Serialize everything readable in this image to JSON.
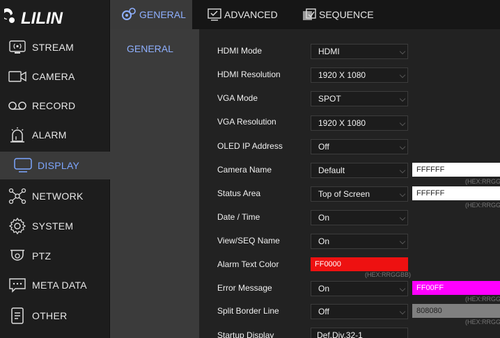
{
  "logo": {
    "text": "LILIN"
  },
  "sidebar": {
    "items": [
      {
        "label": "STREAM",
        "icon": "stream-icon"
      },
      {
        "label": "CAMERA",
        "icon": "camera-icon"
      },
      {
        "label": "RECORD",
        "icon": "record-icon"
      },
      {
        "label": "ALARM",
        "icon": "alarm-icon"
      },
      {
        "label": "DISPLAY",
        "icon": "display-icon",
        "active": true
      },
      {
        "label": "NETWORK",
        "icon": "network-icon"
      },
      {
        "label": "SYSTEM",
        "icon": "system-icon"
      },
      {
        "label": "PTZ",
        "icon": "ptz-icon"
      },
      {
        "label": "META DATA",
        "icon": "metadata-icon"
      },
      {
        "label": "OTHER",
        "icon": "other-icon"
      }
    ]
  },
  "tabs": [
    {
      "label": "GENERAL",
      "active": true
    },
    {
      "label": "ADVANCED"
    },
    {
      "label": "SEQUENCE"
    }
  ],
  "subpanel": {
    "item": "GENERAL"
  },
  "settings": {
    "hdmi_mode": {
      "label": "HDMI Mode",
      "value": "HDMI"
    },
    "hdmi_resolution": {
      "label": "HDMI Resolution",
      "value": "1920 X 1080"
    },
    "vga_mode": {
      "label": "VGA Mode",
      "value": "SPOT"
    },
    "vga_resolution": {
      "label": "VGA Resolution",
      "value": "1920 X 1080"
    },
    "oled_ip": {
      "label": "OLED IP Address",
      "value": "Off"
    },
    "camera_name": {
      "label": "Camera Name",
      "value": "Default",
      "color": "FFFFFF",
      "hint": "(HEX:RRGGB"
    },
    "status_area": {
      "label": "Status Area",
      "value": "Top of Screen",
      "color": "FFFFFF",
      "hint": "(HEX:RRGGB"
    },
    "date_time": {
      "label": "Date / Time",
      "value": "On"
    },
    "view_seq": {
      "label": "View/SEQ Name",
      "value": "On"
    },
    "alarm_text_color": {
      "label": "Alarm Text Color",
      "color": "FF0000",
      "hint": "(HEX:RRGGBB)"
    },
    "error_message": {
      "label": "Error Message",
      "value": "On",
      "color": "FF00FF",
      "hint": "(HEX:RRGGB"
    },
    "split_border": {
      "label": "Split Border Line",
      "value": "Off",
      "color": "808080",
      "hint": "(HEX:RRGGB"
    },
    "startup_display": {
      "label": "Startup Display",
      "value": "Def.Div.32-1"
    }
  },
  "colors": {
    "accent": "#7da6ff",
    "alarm_red": "#ee1111",
    "error_magenta": "#ff00ff",
    "border_gray": "#808080"
  }
}
